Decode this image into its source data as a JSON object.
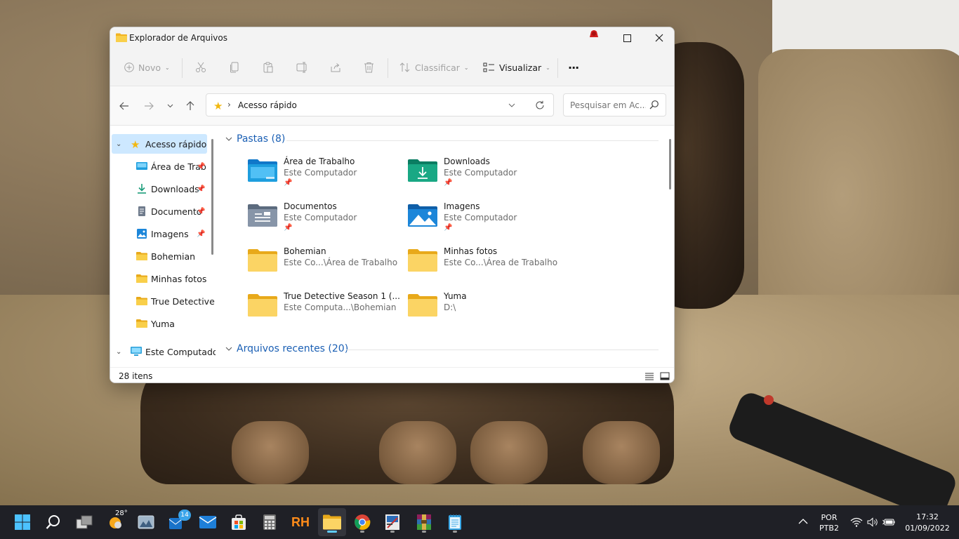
{
  "window": {
    "title": "Explorador de Arquivos"
  },
  "toolbar": {
    "new_label": "Novo",
    "sort_label": "Classificar",
    "view_label": "Visualizar",
    "more_label": "···"
  },
  "address": {
    "separator": "›",
    "path": "Acesso rápido",
    "search_placeholder": "Pesquisar em Ac..."
  },
  "sidebar": {
    "items": [
      {
        "label": "Acesso rápido",
        "icon": "star-icon",
        "pinned": false,
        "selected": true
      },
      {
        "label": "Área de Trab",
        "icon": "desktop-icon",
        "pinned": true
      },
      {
        "label": "Downloads",
        "icon": "download-icon",
        "pinned": true
      },
      {
        "label": "Documento",
        "icon": "document-icon",
        "pinned": true
      },
      {
        "label": "Imagens",
        "icon": "image-icon",
        "pinned": true
      },
      {
        "label": "Bohemian",
        "icon": "folder-icon",
        "pinned": false
      },
      {
        "label": "Minhas fotos",
        "icon": "folder-icon",
        "pinned": false
      },
      {
        "label": "True Detective S",
        "icon": "folder-icon",
        "pinned": false
      },
      {
        "label": "Yuma",
        "icon": "folder-icon",
        "pinned": false
      },
      {
        "label": "Este Computado",
        "icon": "computer-icon",
        "pinned": false
      }
    ]
  },
  "content": {
    "folders_header": "Pastas (8)",
    "recent_header": "Arquivos recentes (20)",
    "folders": [
      {
        "name": "Área de Trabalho",
        "location": "Este Computador",
        "pinned": true,
        "icon": "desktop-folder-icon"
      },
      {
        "name": "Downloads",
        "location": "Este Computador",
        "pinned": true,
        "icon": "downloads-folder-icon"
      },
      {
        "name": "Documentos",
        "location": "Este Computador",
        "pinned": true,
        "icon": "documents-folder-icon"
      },
      {
        "name": "Imagens",
        "location": "Este Computador",
        "pinned": true,
        "icon": "pictures-folder-icon"
      },
      {
        "name": "Bohemian",
        "location": "Este Co...\\Área de Trabalho",
        "pinned": false,
        "icon": "folder-icon"
      },
      {
        "name": "Minhas fotos",
        "location": "Este Co...\\Área de Trabalho",
        "pinned": false,
        "icon": "folder-icon"
      },
      {
        "name": "True Detective Season 1  (...",
        "location": "Este Computa...\\Bohemian",
        "pinned": false,
        "icon": "folder-icon"
      },
      {
        "name": "Yuma",
        "location": "D:\\",
        "pinned": false,
        "icon": "folder-icon"
      }
    ]
  },
  "status": {
    "item_count": "28 itens"
  },
  "taskbar": {
    "weather_temp": "28°",
    "mail_badge": "14",
    "rh_label": "RH",
    "language": "POR",
    "keyboard": "PTB2",
    "time": "17:32",
    "date": "01/09/2022"
  },
  "colors": {
    "accent": "#0067c0",
    "selection": "#cde8ff",
    "folder_yellow": "#f7c948",
    "taskbar_bg": "#1f2026"
  }
}
